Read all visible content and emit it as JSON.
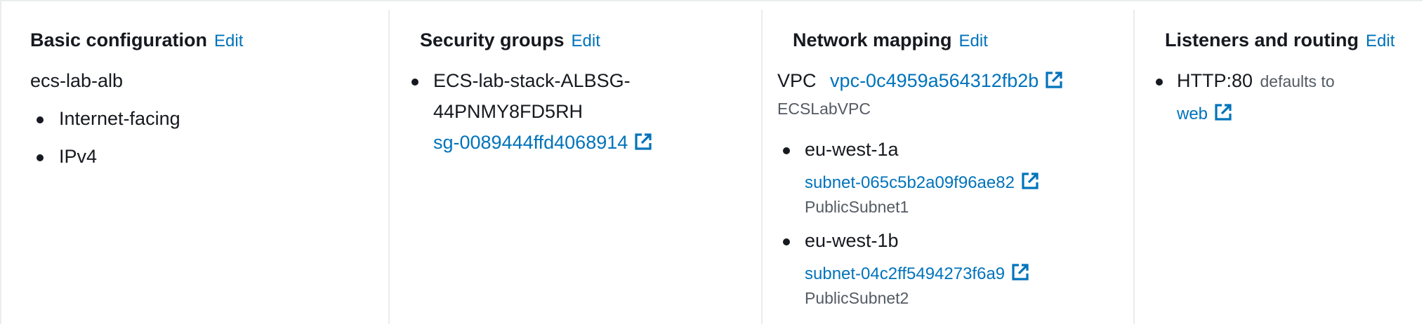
{
  "basic": {
    "title": "Basic configuration",
    "edit": "Edit",
    "name": "ecs-lab-alb",
    "items": [
      "Internet-facing",
      "IPv4"
    ]
  },
  "security": {
    "title": "Security groups",
    "edit": "Edit",
    "group_name_line1": "ECS-lab-stack-ALBSG-",
    "group_name_line2": "44PNMY8FD5RH",
    "group_id": "sg-0089444ffd4068914"
  },
  "network": {
    "title": "Network mapping",
    "edit": "Edit",
    "vpc_label": "VPC",
    "vpc_id": "vpc-0c4959a564312fb2b",
    "vpc_name": "ECSLabVPC",
    "zones": [
      {
        "az": "eu-west-1a",
        "subnet": "subnet-065c5b2a09f96ae82",
        "subnet_name": "PublicSubnet1"
      },
      {
        "az": "eu-west-1b",
        "subnet": "subnet-04c2ff5494273f6a9",
        "subnet_name": "PublicSubnet2"
      }
    ]
  },
  "listeners": {
    "title": "Listeners and routing",
    "edit": "Edit",
    "listener": "HTTP:80",
    "defaults_to": "defaults to",
    "target": "web"
  },
  "icons": {
    "external": "external-link-icon"
  },
  "colors": {
    "link": "#0073bb",
    "text": "#16191f",
    "muted": "#545b64",
    "divider": "#eaeded"
  }
}
